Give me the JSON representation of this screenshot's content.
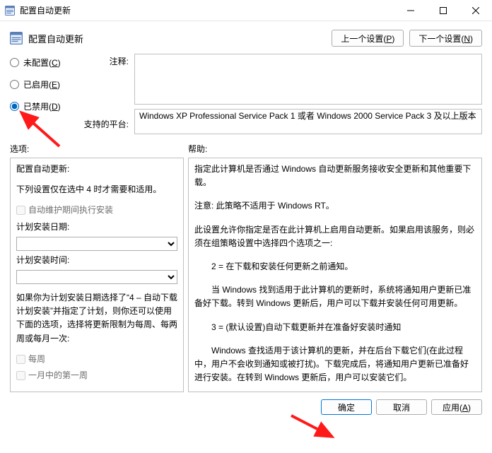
{
  "window": {
    "title": "配置自动更新"
  },
  "header": {
    "policy_title": "配置自动更新",
    "prev_btn": "上一个设置(",
    "prev_mnemonic": "P",
    "prev_btn_suffix": ")",
    "next_btn": "下一个设置(",
    "next_mnemonic": "N",
    "next_btn_suffix": ")"
  },
  "state": {
    "not_configured": "未配置(",
    "not_configured_m": "C",
    "not_configured_suffix": ")",
    "enabled": "已启用(",
    "enabled_m": "E",
    "enabled_suffix": ")",
    "disabled": "已禁用(",
    "disabled_m": "D",
    "disabled_suffix": ")",
    "selected": "disabled"
  },
  "labels": {
    "comment": "注释:",
    "supported": "支持的平台:",
    "options": "选项:",
    "help": "帮助:"
  },
  "supported_text": "Windows XP Professional Service Pack 1 或者 Windows 2000 Service Pack 3 及以上版本",
  "options": {
    "heading": "配置自动更新:",
    "note": "下列设置仅在选中 4 时才需要和适用。",
    "auto_maint": "自动维护期间执行安装",
    "schedule_day_label": "计划安装日期:",
    "schedule_day_value": "",
    "schedule_time_label": "计划安装时间:",
    "schedule_time_value": "",
    "paragraph": "如果你为计划安装日期选择了“4 – 自动下载计划安装”并指定了计划，则你还可以使用下面的选项，选择将更新限制为每周、每两周或每月一次:",
    "weekly": "每周",
    "first_week": "一月中的第一周"
  },
  "help": {
    "p1": "指定此计算机是否通过 Windows 自动更新服务接收安全更新和其他重要下载。",
    "p2": "注意: 此策略不适用于 Windows RT。",
    "p3": "此设置允许你指定是否在此计算机上启用自动更新。如果启用该服务，则必须在组策略设置中选择四个选项之一:",
    "p4": "2 = 在下载和安装任何更新之前通知。",
    "p5": "当 Windows 找到适用于此计算机的更新时，系统将通知用户更新已准备好下载。转到 Windows 更新后，用户可以下载并安装任何可用更新。",
    "p6": "3 = (默认设置)自动下载更新并在准备好安装时通知",
    "p7": "Windows 查找适用于该计算机的更新，并在后台下载它们(在此过程中，用户不会收到通知或被打扰)。下载完成后，将通知用户更新已准备好进行安装。在转到 Windows 更新后，用户可以安装它们。"
  },
  "footer": {
    "ok": "确定",
    "cancel": "取消",
    "apply": "应用(",
    "apply_m": "A",
    "apply_suffix": ")"
  }
}
